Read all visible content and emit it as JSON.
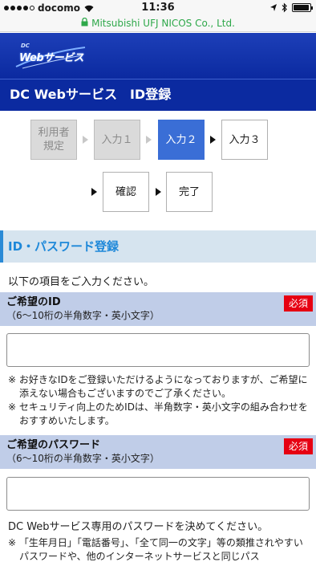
{
  "status_bar": {
    "carrier": "docomo",
    "time": "11:36",
    "signal_bars": 4,
    "battery_level": 0.95
  },
  "url_bar": {
    "site_name": "Mitsubishi UFJ NICOS Co., Ltd.",
    "secure": true
  },
  "header": {
    "logo_small": "DC",
    "logo_text": "Webサービス",
    "title": "DC Webサービス　ID登録"
  },
  "steps": [
    {
      "label": "利用者\n規定",
      "state": "done"
    },
    {
      "label": "入力１",
      "state": "done"
    },
    {
      "label": "入力２",
      "state": "active"
    },
    {
      "label": "入力３",
      "state": "todo"
    },
    {
      "label": "確認",
      "state": "todo"
    },
    {
      "label": "完了",
      "state": "todo"
    }
  ],
  "form": {
    "section_title": "ID・パスワード登録",
    "intro": "以下の項目をご入力ください。",
    "id_field": {
      "label": "ご希望のID",
      "sub": "（6〜10桁の半角数字・英小文字）",
      "required_badge": "必須",
      "value": "",
      "notes": [
        "※ お好きなIDをご登録いただけるようになっておりますが、ご希望に添えない場合もございますのでご了承ください。",
        "※ セキュリティ向上のためIDは、半角数字・英小文字の組み合わせをおすすめいたします。"
      ]
    },
    "password_field": {
      "label": "ご希望のパスワード",
      "sub": "（6〜10桁の半角数字・英小文字）",
      "required_badge": "必須",
      "value": "",
      "description": "DC Webサービス専用のパスワードを決めてください。",
      "notes": [
        "※ 「生年月日」「電話番号」、「全て同一の文字」等の類推されやすいパスワードや、他のインターネットサービスと同じパス"
      ]
    }
  },
  "colors": {
    "header_blue": "#0b2aa0",
    "active_step": "#3a6ed6",
    "section_heading_bg": "#d6e4ef",
    "section_heading_text": "#1e88d9",
    "field_head_bg": "#c0cde8",
    "required_red": "#e60012",
    "url_green": "#2ea84a"
  }
}
